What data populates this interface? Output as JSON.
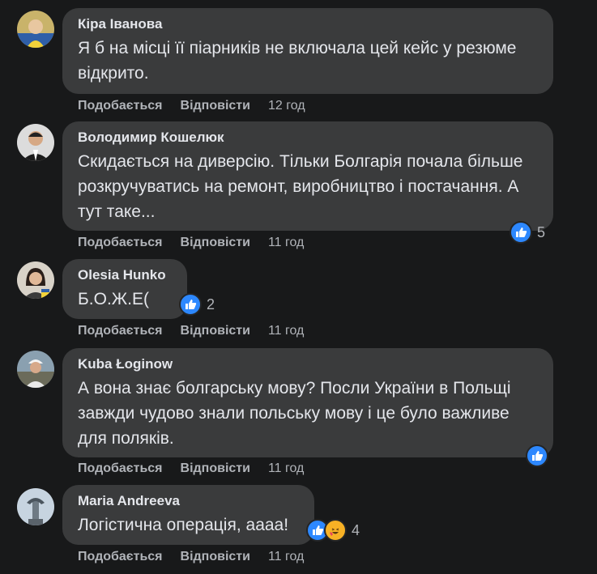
{
  "comments": [
    {
      "author": "Кіра Іванова",
      "text": "Я б на місці її піарників не включала цей кейс у резюме відкрито.",
      "time": "12 год",
      "reactions": null
    },
    {
      "author": "Володимир Кошелюк",
      "text": "Скидається на диверсію. Тільки Болгарія почала більше розкручуватись на ремонт, виробництво і постачання. А тут таке...",
      "time": "11 год",
      "reactions": {
        "count": "5",
        "icons": [
          "like-icon"
        ]
      }
    },
    {
      "author": "Olesia Hunko",
      "text": "Б.О.Ж.Е(",
      "time": "11 год",
      "reactions": {
        "count": "2",
        "icons": [
          "like-icon"
        ]
      }
    },
    {
      "author": "Kuba Łoginow",
      "text": "А вона знає болгарську мову? Посли України в Польщі завжди чудово знали польську мову і це було важливе для поляків.",
      "time": "11 год",
      "reactions": {
        "count": "",
        "icons": [
          "like-icon"
        ]
      }
    },
    {
      "author": "Maria Andreeva",
      "text": "Логістична операція, аааа!",
      "time": "11 год",
      "reactions": {
        "count": "4",
        "icons": [
          "like-icon",
          "haha-icon"
        ]
      }
    }
  ],
  "actions": {
    "like_label": "Подобається",
    "reply_label": "Відповісти"
  },
  "colors": {
    "background": "#18191a",
    "bubble": "#3a3b3c",
    "text": "#e4e6eb",
    "secondary": "#b0b3b8",
    "like": "#2d88ff",
    "haha": "#f7b125"
  }
}
